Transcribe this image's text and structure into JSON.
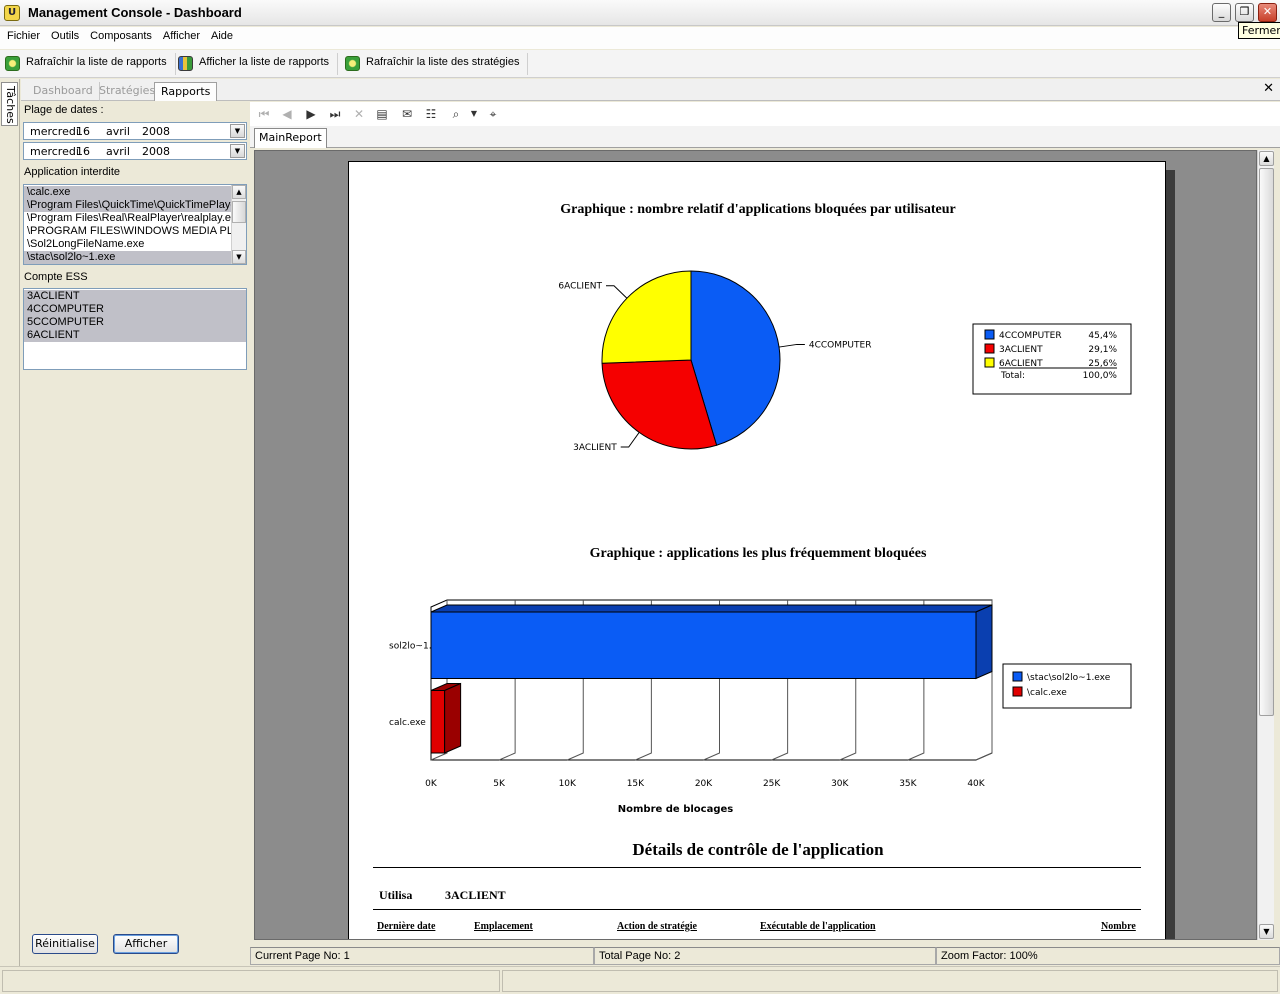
{
  "window": {
    "title": "Management Console  - Dashboard",
    "tooltip": "Fermer"
  },
  "menu": {
    "items": [
      "Fichier",
      "Outils",
      "Composants",
      "Afficher",
      "Aide"
    ]
  },
  "toolbar": {
    "refresh_reports": "Rafraîchir la liste de rapports",
    "show_reports": "Afficher la liste de rapports",
    "refresh_strategies": "Rafraîchir la liste des stratégies"
  },
  "side_tab": "Tâches",
  "tabs": [
    "Dashboard",
    "Stratégies",
    "Rapports"
  ],
  "filters": {
    "date_range_label": "Plage de dates :",
    "date_from": {
      "weekday": "mercredi",
      "day": "16",
      "month": "avril",
      "year": "2008"
    },
    "date_to": {
      "weekday": "mercredi",
      "day": "16",
      "month": "avril",
      "year": "2008"
    },
    "blocked_app_label": "Application interdite",
    "blocked_apps": [
      "\\calc.exe",
      "\\Program Files\\QuickTime\\QuickTimePlayer.exe",
      "\\Program Files\\Real\\RealPlayer\\realplay.exe",
      "\\PROGRAM FILES\\WINDOWS MEDIA PLAYER\\wmplayer.exe",
      "\\Sol2LongFileName.exe",
      "\\stac\\sol2lo~1.exe"
    ],
    "ess_account_label": "Compte ESS",
    "ess_accounts": [
      "3ACLIENT",
      "4CCOMPUTER",
      "5CCOMPUTER",
      "6ACLIENT"
    ],
    "reset_button": "Réinitialise",
    "show_button": "Afficher"
  },
  "report": {
    "tab": "MainReport",
    "pie_title": "Graphique : nombre relatif d'applications bloquées par utilisateur",
    "bar_title": "Graphique :  applications les plus fréquemment bloquées",
    "details_title": "Détails de contrôle de l'application",
    "user_label": "Utilisa",
    "user_value": "3ACLIENT",
    "columns": [
      "Dernière date",
      "Emplacement",
      "Action de stratégie",
      "Exécutable de l'application",
      "Nombre"
    ]
  },
  "chart_data": [
    {
      "type": "pie",
      "title": "Graphique : nombre relatif d'applications bloquées par utilisateur",
      "categories": [
        "4CCOMPUTER",
        "3ACLIENT",
        "6ACLIENT"
      ],
      "values": [
        45.4,
        29.1,
        25.6
      ],
      "value_labels": [
        "45,4%",
        "29,1%",
        "25,6%"
      ],
      "colors": [
        "#0a5cf5",
        "#f50000",
        "#ffff00"
      ],
      "legend": {
        "placement": "right",
        "total_label": "Total:",
        "total_value": "100,0%"
      }
    },
    {
      "type": "bar",
      "orientation": "horizontal",
      "title": "Graphique :  applications les plus fréquemment bloquées",
      "categories": [
        "sol2lo~1.",
        "calc.exe"
      ],
      "series": [
        {
          "name": "\\stac\\sol2lo~1.exe",
          "values": [
            40000
          ],
          "color": "#0a5cf5"
        },
        {
          "name": "\\calc.exe",
          "values": [
            1000
          ],
          "color": "#e00000"
        }
      ],
      "xlabel": "Nombre de blocages",
      "xlim": [
        0,
        40000
      ],
      "xticks": [
        "0K",
        "5K",
        "10K",
        "15K",
        "20K",
        "25K",
        "30K",
        "35K",
        "40K"
      ],
      "grid": true,
      "legend": {
        "placement": "right"
      }
    }
  ],
  "status": {
    "current_page": "Current Page No: 1",
    "total_pages": "Total Page No: 2",
    "zoom": "Zoom Factor: 100%"
  }
}
